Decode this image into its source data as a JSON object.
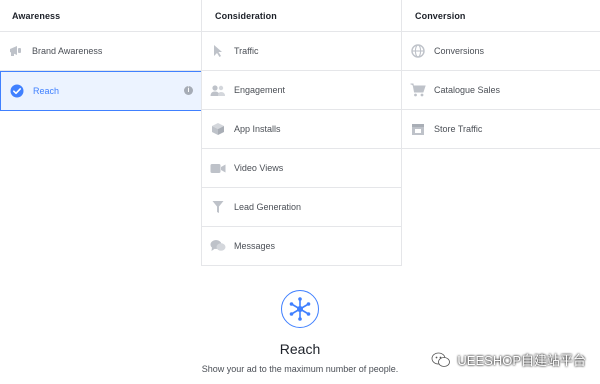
{
  "columns": [
    {
      "header": "Awareness",
      "items": [
        {
          "label": "Brand Awareness",
          "icon": "megaphone-icon"
        },
        {
          "label": "Reach",
          "icon": "check-circle-icon",
          "selected": true,
          "info": "i"
        }
      ]
    },
    {
      "header": "Consideration",
      "items": [
        {
          "label": "Traffic",
          "icon": "cursor-icon"
        },
        {
          "label": "Engagement",
          "icon": "people-icon"
        },
        {
          "label": "App Installs",
          "icon": "box-icon"
        },
        {
          "label": "Video Views",
          "icon": "video-camera-icon"
        },
        {
          "label": "Lead Generation",
          "icon": "funnel-icon"
        },
        {
          "label": "Messages",
          "icon": "chat-bubbles-icon"
        }
      ]
    },
    {
      "header": "Conversion",
      "items": [
        {
          "label": "Conversions",
          "icon": "globe-icon"
        },
        {
          "label": "Catalogue Sales",
          "icon": "shopping-cart-icon"
        },
        {
          "label": "Store Traffic",
          "icon": "store-icon"
        }
      ]
    }
  ],
  "detail": {
    "icon": "reach-network-icon",
    "title": "Reach",
    "description": "Show your ad to the maximum number of people."
  },
  "watermark": {
    "text": "UEESHOP自建站平台"
  },
  "colors": {
    "accent": "#4080ff",
    "selected_bg": "#ecf3ff",
    "border": "#e5e6e9",
    "icon_gray": "#bec2c9",
    "text": "#4b4f56",
    "header_text": "#1d2129"
  }
}
